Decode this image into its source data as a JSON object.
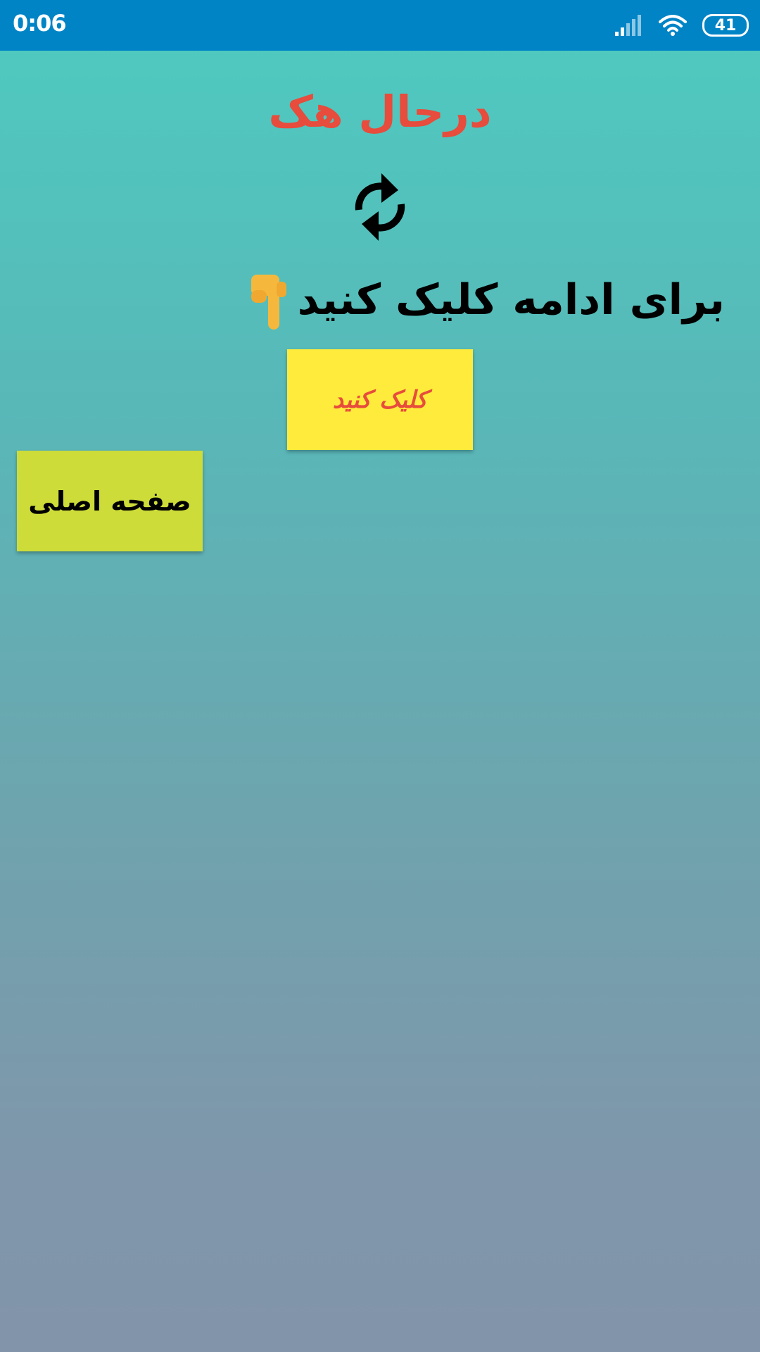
{
  "status_bar": {
    "time": "0:06",
    "battery": "41",
    "signal_icon": "signal-icon",
    "wifi_icon": "wifi-icon"
  },
  "main": {
    "title": "درحال هک",
    "refresh_icon": "refresh-icon",
    "instruction": "برای ادامه کلیک کنید",
    "pointing_icon": "pointing-down-icon",
    "click_button_label": "کلیک کنید",
    "home_button_label": "صفحه اصلی"
  },
  "colors": {
    "status_bar": "#0084c6",
    "title": "#e74c3c",
    "click_button_bg": "#ffeb3b",
    "click_button_text": "#e74c3c",
    "home_button_bg": "#cddc39",
    "background_top": "#4ecbc0",
    "background_bottom": "#8294aa"
  }
}
